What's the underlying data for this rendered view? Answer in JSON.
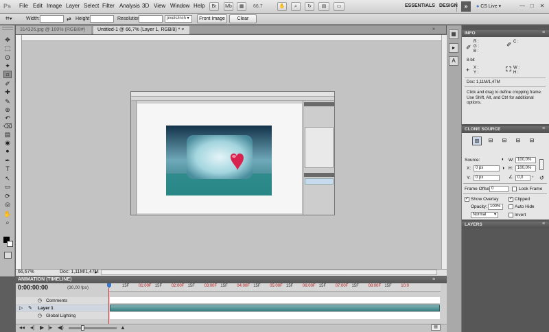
{
  "app": {
    "logo": "Ps"
  },
  "menu": [
    "File",
    "Edit",
    "Image",
    "Layer",
    "Select",
    "Filter",
    "Analysis",
    "3D",
    "View",
    "Window",
    "Help"
  ],
  "menubar_mini": {
    "br": "Br",
    "mb": "Mb",
    "zoom": "66,7"
  },
  "workspace": {
    "essentials": "ESSENTIALS",
    "design": "DESIGN",
    "more": "»",
    "cs_live": "CS Live"
  },
  "window_controls": {
    "minimize": "—",
    "restore": "□",
    "close": "✕"
  },
  "options_bar": {
    "width_label": "Width:",
    "height_label": "Height:",
    "resolution_label": "Resolution:",
    "unit_value": "pixels/inch",
    "front_image": "Front Image",
    "clear": "Clear"
  },
  "tabs": [
    {
      "label": "314326.jpg @ 100% (RGB/8#)"
    },
    {
      "label": "Untitled-1 @ 66,7% (Layer 1, RGB/8) *",
      "close": "×"
    }
  ],
  "status": {
    "zoom": "66,67%",
    "doc": "Doc: 1,11M/1,47M"
  },
  "timeline": {
    "title": "ANIMATION (TIMELINE)",
    "time": "0:00:00:00",
    "fps": "(30,00 fps)",
    "ticks": [
      "15F",
      "01:00F",
      "15F",
      "02:00F",
      "15F",
      "03:00F",
      "15F",
      "04:00F",
      "15F",
      "05:00F",
      "15F",
      "06:00F",
      "15F",
      "07:00F",
      "15F",
      "08:00F",
      "15F",
      "10:0"
    ],
    "rows": {
      "comments": "Comments",
      "layer": "Layer 1",
      "global": "Global Lighting"
    }
  },
  "info_panel": {
    "title": "INFO",
    "r": "R :",
    "g": "G :",
    "b": "B :",
    "c": "C :",
    "m": "M :",
    "y": "Y :",
    "k": "K :",
    "bit": "8-bit",
    "x": "X :",
    "yy": "Y :",
    "w": "W :",
    "h": "H :",
    "doc": "Doc: 1,11M/1,47M",
    "hint": "Click and drag to define cropping frame. Use Shift, Alt, and Ctrl for additional options."
  },
  "clone_source": {
    "title": "CLONE SOURCE",
    "source_label": "Source:",
    "x_label": "X:",
    "x_value": "0 px",
    "y_label": "Y:",
    "y_value": "0 px",
    "w_label": "W:",
    "w_value": "100,0%",
    "h_label": "H:",
    "h_value": "100,0%",
    "angle_value": "0,0",
    "angle_unit": "°",
    "frame_offset_label": "Frame Offset:",
    "frame_offset_value": "0",
    "lock_frame": "Lock Frame",
    "show_overlay": "Show Overlay",
    "clipped": "Clipped",
    "opacity_label": "Opacity:",
    "opacity_value": "100%",
    "auto_hide": "Auto Hide",
    "blend_mode": "Normal",
    "invert": "Invert"
  },
  "layers_panel": {
    "title": "LAYERS"
  },
  "icons": {
    "tool_icons": [
      "move-tool-icon",
      "marquee-tool-icon",
      "lasso-tool-icon",
      "quick-selection-icon",
      "crop-tool-icon",
      "eyedropper-icon",
      "healing-brush-icon",
      "brush-tool-icon",
      "clone-stamp-icon",
      "history-brush-icon",
      "eraser-icon",
      "gradient-icon",
      "blur-icon",
      "dodge-icon",
      "pen-tool-icon",
      "type-tool-icon",
      "path-selection-icon",
      "shape-tool-icon",
      "3d-rotate-icon",
      "3d-orbit-icon",
      "hand-tool-icon",
      "zoom-tool-icon"
    ]
  },
  "colors": {
    "accent_blue": "#3d78c8",
    "timeline_red": "#b52020",
    "panel_dark": "#575757"
  }
}
